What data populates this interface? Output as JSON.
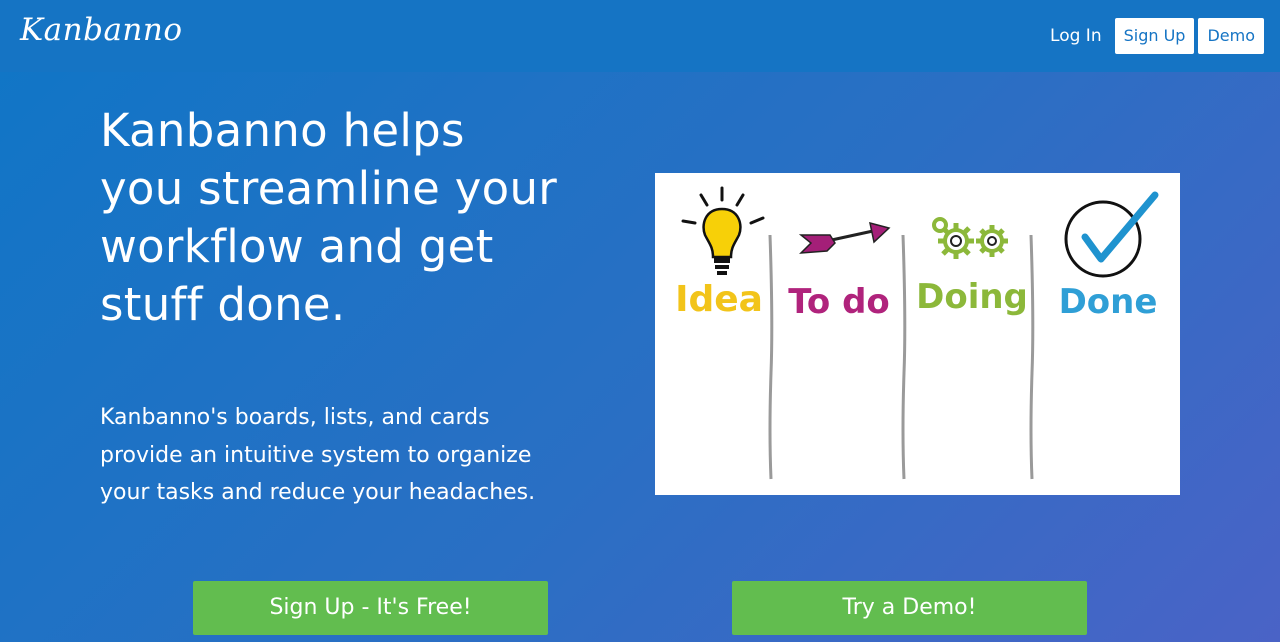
{
  "header": {
    "logo": "Kanbanno",
    "login_label": "Log In",
    "signup_label": "Sign Up",
    "demo_label": "Demo"
  },
  "hero": {
    "headline": "Kanbanno helps you streamline your workflow and get stuff done.",
    "subtext": "Kanbanno's boards, lists, and cards provide an intuitive system to organize your tasks and reduce your headaches."
  },
  "illustration": {
    "columns": [
      {
        "label": "Idea",
        "icon": "lightbulb-icon",
        "color": "#f2c41a"
      },
      {
        "label": "To do",
        "icon": "arrow-icon",
        "color": "#b0237c"
      },
      {
        "label": "Doing",
        "icon": "gears-icon",
        "color": "#8cb83a"
      },
      {
        "label": "Done",
        "icon": "checkmark-icon",
        "color": "#2f9fd6"
      }
    ]
  },
  "cta": {
    "signup_label": "Sign Up - It's Free!",
    "demo_label": "Try a Demo!"
  },
  "colors": {
    "header_bg": "#1574c4",
    "cta_green": "#62bd4f",
    "nav_button_text": "#1574c4"
  }
}
